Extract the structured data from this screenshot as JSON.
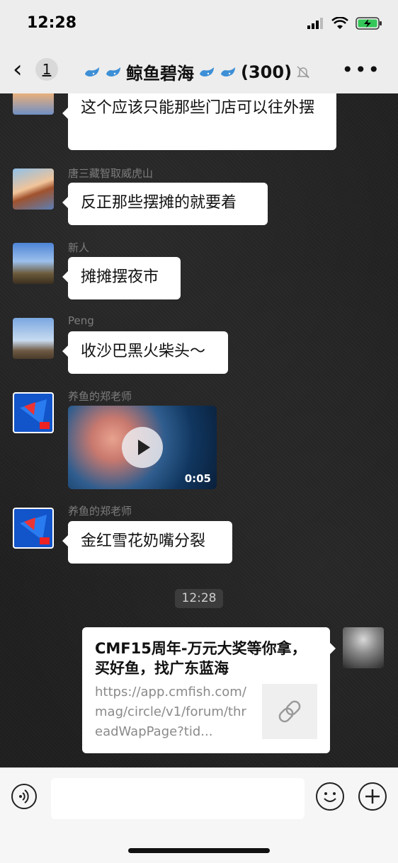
{
  "status_bar": {
    "time": "12:28"
  },
  "nav": {
    "back_icon": "chevron-left-icon",
    "unread_count": "1",
    "title_prefix_icons": [
      "whale-icon",
      "whale-icon"
    ],
    "title_text": "鲸鱼碧海",
    "title_suffix_icons": [
      "whale-icon",
      "whale-icon"
    ],
    "member_count": "(300)",
    "muted_icon": "bell-off-icon",
    "more_icon": "more-icon"
  },
  "messages": [
    {
      "sender": "",
      "text": "这个应该只能那些门店可以往外摆"
    },
    {
      "sender": "唐三藏智取威虎山",
      "text": "反正那些摆摊的就要着"
    },
    {
      "sender": "新人",
      "text": "摊摊摆夜市"
    },
    {
      "sender": "Peng",
      "text": "收沙巴黑火柴头～"
    },
    {
      "sender": "养鱼的郑老师",
      "video_duration": "0:05"
    },
    {
      "sender": "养鱼的郑老师",
      "text": "金红雪花奶嘴分裂"
    }
  ],
  "timestamp": "12:28",
  "link_card": {
    "title": "CMF15周年-万元大奖等你拿，买好鱼，找广东蓝海",
    "url": "https://app.cmfish.com/mag/circle/v1/forum/threadWapPage?tid...",
    "thumb_icon": "link-icon"
  },
  "input_bar": {
    "voice_icon": "voice-icon",
    "emoji_icon": "emoji-icon",
    "plus_icon": "plus-icon",
    "input_value": ""
  }
}
